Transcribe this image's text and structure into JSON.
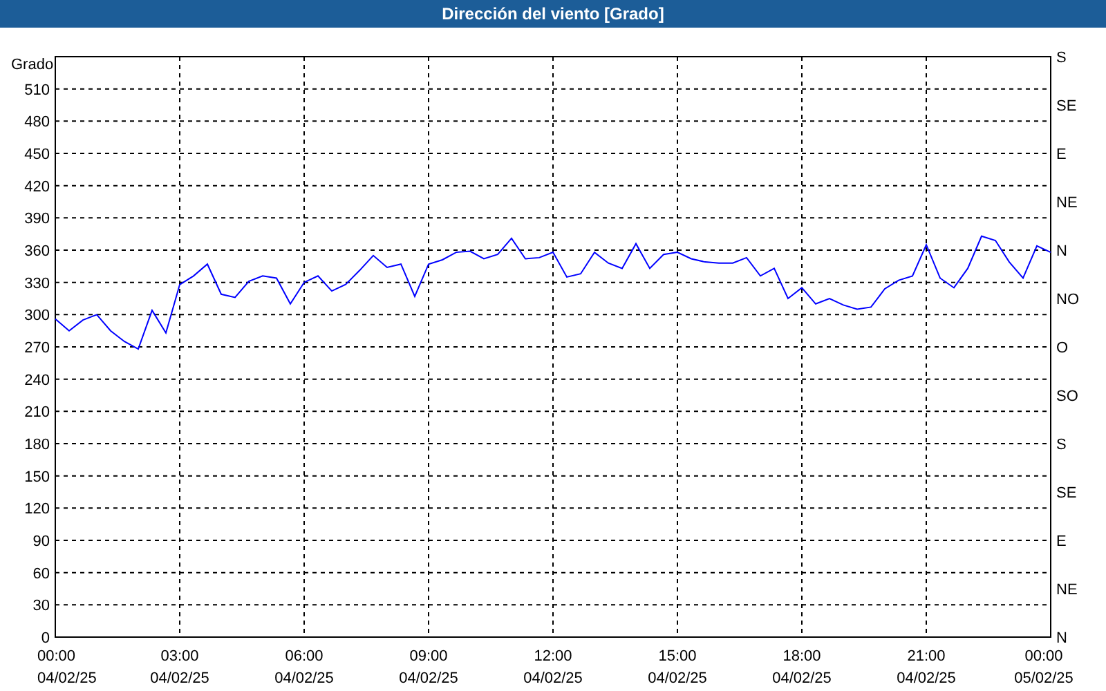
{
  "window": {
    "title": "Dirección del viento [Grado]"
  },
  "chart": {
    "chart_data": {
      "type": "line",
      "grid": true,
      "ylabel": "Grado",
      "ylim": [
        0,
        540
      ],
      "categories": [
        "00:00\n04/02/25",
        null,
        null,
        null,
        null,
        null,
        null,
        null,
        null,
        "03:00\n04/02/25",
        null,
        null,
        null,
        null,
        null,
        null,
        null,
        null,
        "06:00\n04/02/25",
        null,
        null,
        null,
        null,
        null,
        null,
        null,
        null,
        "09:00\n04/02/25",
        null,
        null,
        null,
        null,
        null,
        null,
        null,
        null,
        "12:00\n04/02/25",
        null,
        null,
        null,
        null,
        null,
        null,
        null,
        null,
        "15:00\n04/02/25",
        null,
        null,
        null,
        null,
        null,
        null,
        null,
        null,
        "18:00\n04/02/25",
        null,
        null,
        null,
        null,
        null,
        null,
        null,
        null,
        "21:00\n04/02/25",
        null,
        null,
        null,
        null,
        null,
        null,
        null,
        null,
        "00:00\n05/02/25"
      ],
      "series": [
        {
          "color": "#0000ff",
          "values": [
            296,
            285,
            295,
            300,
            285,
            275,
            268,
            304,
            283,
            328,
            336,
            347,
            319,
            316,
            331,
            336,
            334,
            310,
            330,
            336,
            322,
            328,
            341,
            355,
            344,
            347,
            317,
            347,
            351,
            358,
            359,
            352,
            356,
            371,
            352,
            353,
            358,
            335,
            338,
            358,
            348,
            343,
            366,
            343,
            356,
            358,
            352,
            349,
            348,
            348,
            353,
            336,
            343,
            315,
            325,
            310,
            315,
            309,
            305,
            307,
            324,
            332,
            336,
            365,
            334,
            325,
            343,
            373,
            369,
            349,
            334,
            364,
            358
          ]
        }
      ],
      "yticks": [
        0,
        30,
        60,
        90,
        120,
        150,
        180,
        210,
        240,
        270,
        300,
        330,
        360,
        390,
        420,
        450,
        480,
        510
      ]
    },
    "right_axis_labels": [
      "S",
      "SE",
      "E",
      "NE",
      "N",
      "NO",
      "O",
      "SO",
      "S",
      "SE",
      "E",
      "NE",
      "N"
    ]
  }
}
